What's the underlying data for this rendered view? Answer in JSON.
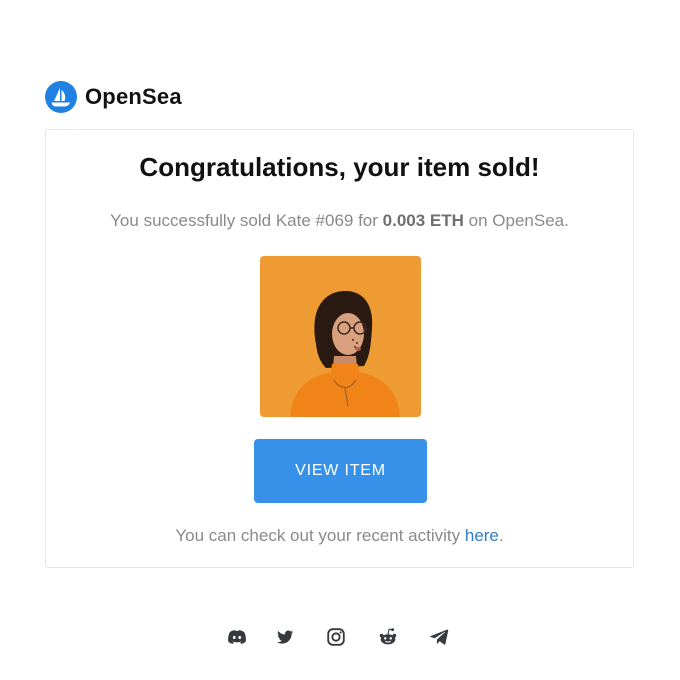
{
  "brand": {
    "name": "OpenSea"
  },
  "email": {
    "title": "Congratulations, your item sold!",
    "message": {
      "prefix": "You successfully sold Kate #069 for ",
      "price": "0.003 ETH",
      "suffix": " on OpenSea."
    },
    "item_image_alt": "Kate #069",
    "button_label": "VIEW ITEM",
    "activity": {
      "prefix": "You can check out your recent activity ",
      "link_label": "here",
      "suffix": "."
    }
  },
  "social": [
    {
      "icon": "discord-icon"
    },
    {
      "icon": "twitter-icon"
    },
    {
      "icon": "instagram-icon"
    },
    {
      "icon": "reddit-icon"
    },
    {
      "icon": "telegram-icon"
    }
  ],
  "colors": {
    "accent": "#3891e8",
    "link": "#2e80c8",
    "brand_blue": "#2081e2",
    "image_background": "#f2a23a"
  }
}
